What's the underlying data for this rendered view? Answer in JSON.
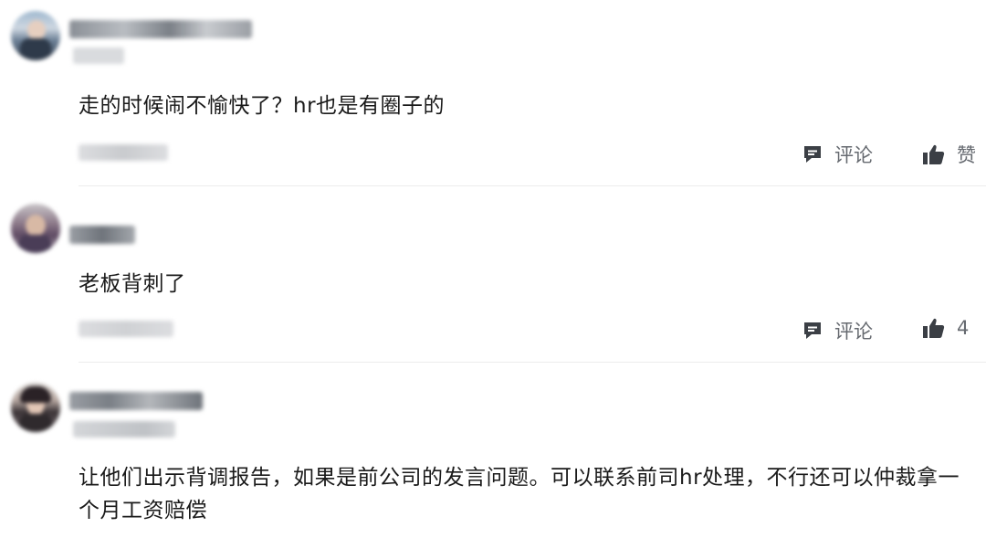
{
  "colors": {
    "text": "#1a1a1a",
    "action": "#666a70",
    "icon": "#3b3f45",
    "divider": "#ececec"
  },
  "comments": [
    {
      "text": "走的时候闹不愉快了？hr也是有圈子的",
      "actions": {
        "comment_label": "评论",
        "comment_icon": "comment-icon",
        "like_label": "赞",
        "like_icon": "thumbs-up-icon"
      }
    },
    {
      "text": "老板背刺了",
      "actions": {
        "comment_label": "评论",
        "comment_icon": "comment-icon",
        "like_label": "4",
        "like_icon": "thumbs-up-icon"
      }
    },
    {
      "text": "让他们出示背调报告，如果是前公司的发言问题。可以联系前司hr处理，不行还可以仲裁拿一个月工资赔偿",
      "actions": null
    }
  ]
}
